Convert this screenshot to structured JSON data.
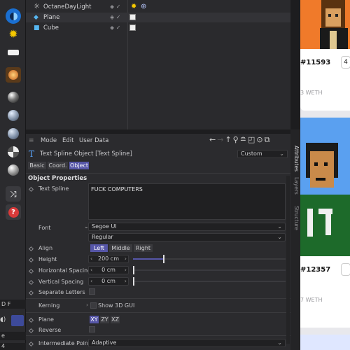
{
  "left_toolbar": {
    "tools": [
      "sky-icon",
      "daylight-icon",
      "light-icon",
      "explosion-icon",
      "material-icon",
      "material-icon",
      "material-icon",
      "material-icon",
      "material-icon",
      "shuffle-icon",
      "help-icon"
    ],
    "partial_text": [
      "D F",
      "e",
      "4"
    ]
  },
  "object_manager": {
    "objects": [
      {
        "name": "OctaneDayLight",
        "icon": "sun-icon"
      },
      {
        "name": "Plane",
        "icon": "plane-icon"
      },
      {
        "name": "Cube",
        "icon": "cube-icon"
      }
    ]
  },
  "attributes": {
    "menu": [
      "Mode",
      "Edit",
      "User Data"
    ],
    "object_title": "Text Spline Object [Text Spline]",
    "preset": "Custom",
    "tabs": [
      "Basic",
      "Coord.",
      "Object"
    ],
    "active_tab": "Object",
    "section_title": "Object Properties",
    "text_spline_label": "Text Spline",
    "text_value": "FUCK COMPUTERS",
    "font_label": "Font",
    "font_value": "Segoe UI",
    "font_style": "Regular",
    "align_label": "Align",
    "align_options": [
      "Left",
      "Middle",
      "Right"
    ],
    "align_selected": "Left",
    "height_label": "Height",
    "height_value": "200 cm",
    "height_slider_fraction": 0.2,
    "hspacing_label": "Horizontal Spacing",
    "hspacing_value": "0 cm",
    "vspacing_label": "Vertical Spacing",
    "vspacing_value": "0 cm",
    "separate_label": "Separate Letters",
    "kerning_label": "Kerning",
    "show3d_label": "Show 3D GUI",
    "plane_label": "Plane",
    "plane_options": [
      "XY",
      "ZY",
      "XZ"
    ],
    "plane_selected": "XY",
    "reverse_label": "Reverse",
    "interp_label": "Intermediate Points",
    "interp_value": "Adaptive"
  },
  "side_tabs": [
    "Attributes",
    "Layers",
    "Structure"
  ],
  "web": {
    "items": [
      {
        "id": "#11593",
        "price": "3 WETH"
      },
      {
        "id": "#12357",
        "price": "7 WETH"
      }
    ]
  },
  "colors": {
    "accent": "#5656a8",
    "panel": "#2b2b2e",
    "field": "#202022"
  }
}
